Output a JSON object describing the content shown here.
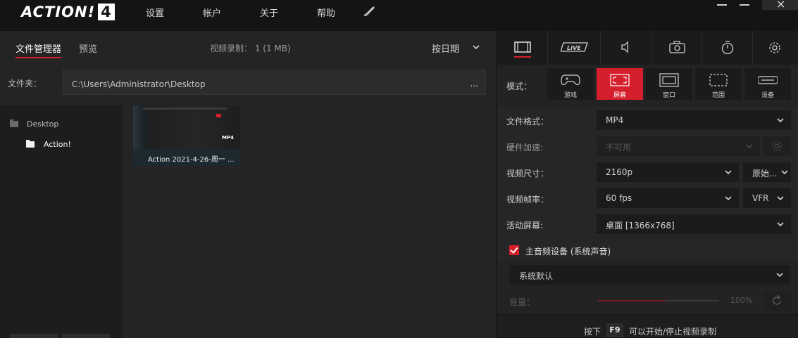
{
  "app": {
    "logo_text": "ACTION!",
    "logo_version": "4"
  },
  "menu": [
    "设置",
    "帐户",
    "关于",
    "帮助"
  ],
  "left": {
    "tabs": {
      "file_manager": "文件管理器",
      "preview": "预览"
    },
    "recording_info": "视频录制： 1 (1 MB)",
    "sort_label": "按日期",
    "folder_label": "文件夹：",
    "folder_path": "C:\\Users\\Administrator\\Desktop",
    "folder_more": "...",
    "tree": [
      {
        "label": "Desktop"
      },
      {
        "label": "Action!"
      }
    ],
    "files": [
      {
        "caption": "Action 2021-4-26-周一 ...",
        "thumb_text": "MP4"
      }
    ]
  },
  "right": {
    "tabs": [
      "video-tab",
      "live-tab",
      "audio-tab",
      "screenshot-tab",
      "timer-tab",
      "settings-tab"
    ],
    "live_label": "LIVE",
    "mode_label": "模式：",
    "modes": [
      {
        "label": "游戏",
        "active": false
      },
      {
        "label": "屏幕",
        "active": true
      },
      {
        "label": "窗口",
        "active": false
      },
      {
        "label": "范围",
        "active": false
      },
      {
        "label": "设备",
        "active": false
      }
    ],
    "settings": {
      "format": {
        "label": "文件格式：",
        "value": "MP4"
      },
      "hw_accel": {
        "label": "硬件加速:",
        "value": "不可用"
      },
      "size": {
        "label": "视频尺寸：",
        "value": "2160p",
        "extra": "原始..."
      },
      "framerate": {
        "label": "视频帧率：",
        "value": "60 fps",
        "extra": "VFR"
      },
      "active_screen": {
        "label": "活动屏幕:",
        "value": "桌面 [1366x768]"
      }
    },
    "audio": {
      "checkbox_label": "主音频设备 (系统声音)",
      "checked": true,
      "device": "系统默认",
      "volume_label": "音量：",
      "volume_value": "100%",
      "volume_level": 0.55
    },
    "hint": {
      "before": "按下",
      "key": "F9",
      "after": "可以开始/停止视频录制"
    }
  },
  "colors": {
    "accent": "#d61f2c",
    "background": "#1e1e1e",
    "panel": "#242424"
  }
}
